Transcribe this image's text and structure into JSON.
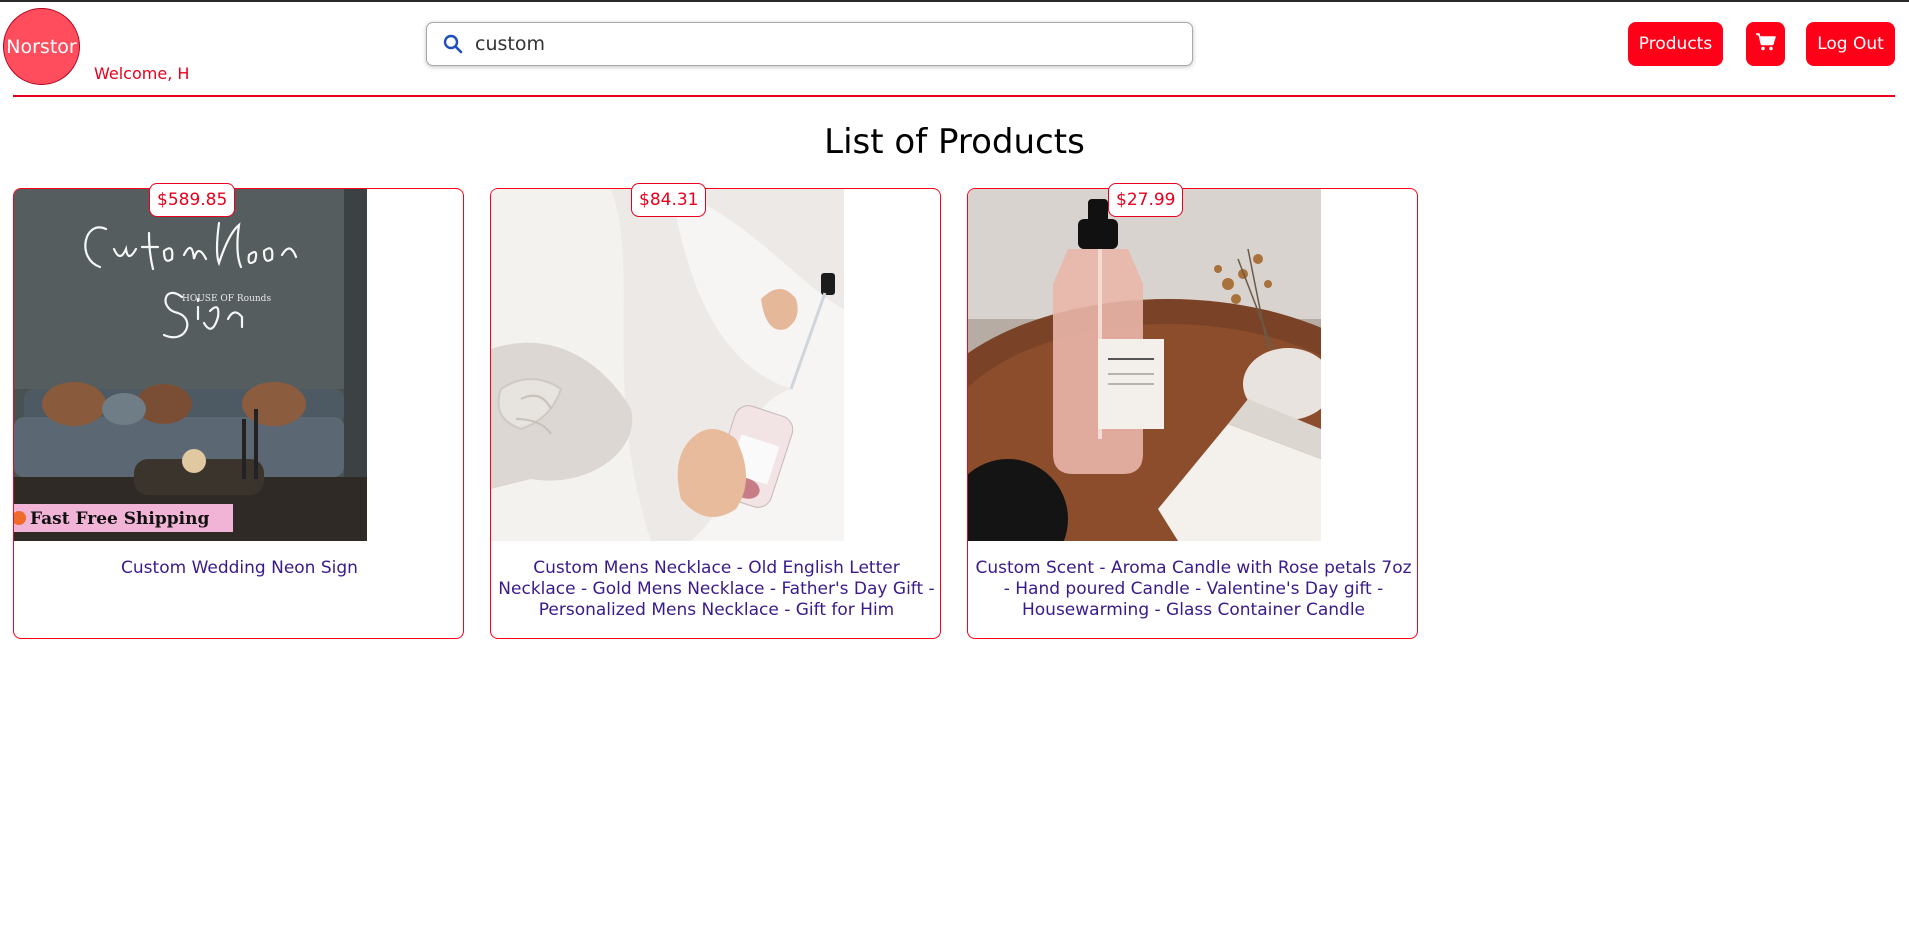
{
  "header": {
    "logo_text": "Norstor",
    "welcome": "Welcome, H",
    "search": {
      "value": "custom",
      "placeholder": ""
    },
    "nav": {
      "products": "Products",
      "logout": "Log Out"
    },
    "cart_icon": "cart-icon",
    "search_icon": "search-icon"
  },
  "main": {
    "title": "List of Products",
    "products": [
      {
        "price": "$589.85",
        "name": "Custom Wedding Neon Sign",
        "image_text": {
          "line1": "Custom Neon",
          "line2": "Sign",
          "brand": "HOUSE OF Rounds",
          "banner": "Fast Free Shipping"
        }
      },
      {
        "price": "$84.31",
        "name": "Custom Mens Necklace - Old English Letter Necklace - Gold Mens Necklace - Father's Day Gift - Personalized Mens Necklace - Gift for Him"
      },
      {
        "price": "$27.99",
        "name": "Custom Scent - Aroma Candle with Rose petals 7oz - Hand poured Candle - Valentine's Day gift - Housewarming - Glass Container Candle"
      }
    ]
  },
  "colors": {
    "accent": "#ff0019",
    "link": "#3a1a8a",
    "logo_bg": "#ff4d5e"
  }
}
